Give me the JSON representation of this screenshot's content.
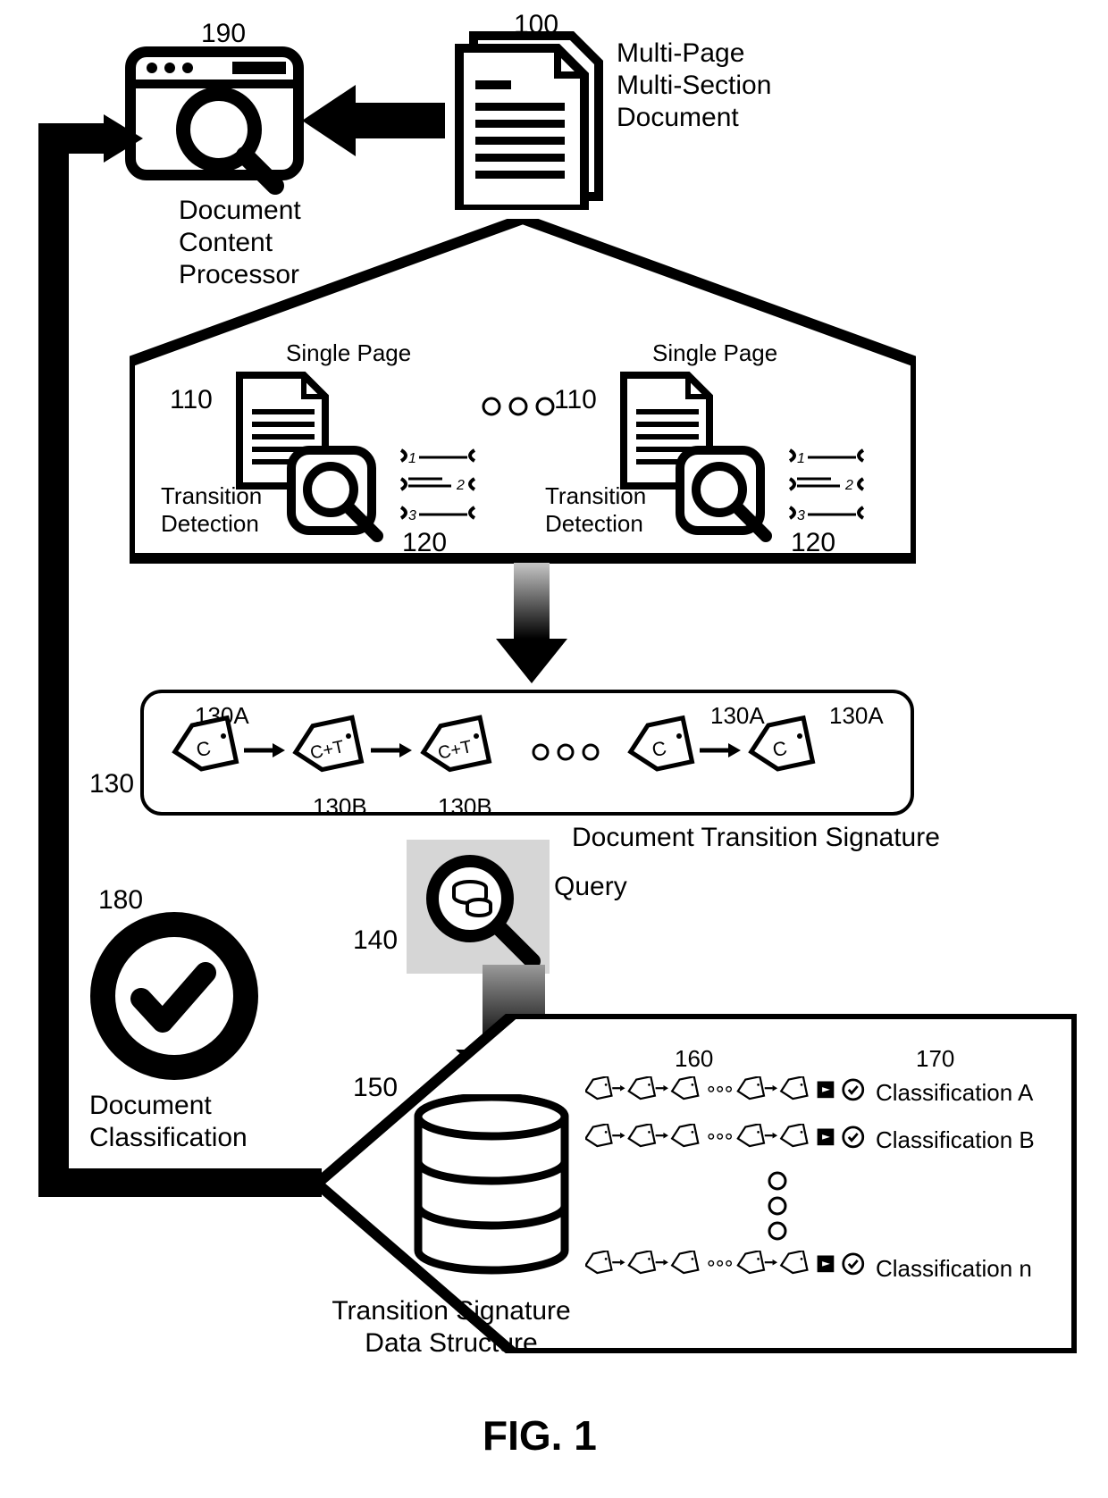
{
  "figure_label": "FIG. 1",
  "refs": {
    "doc": "100",
    "dcp": "190",
    "page_left": "110",
    "page_right": "110",
    "td_left": "120",
    "td_right": "120",
    "sig_box": "130",
    "tag_a1": "130A",
    "tag_b1": "130B",
    "tag_b2": "130B",
    "tag_a2": "130A",
    "tag_a3": "130A",
    "query": "140",
    "db": "150",
    "chain": "160",
    "class": "170",
    "result": "180"
  },
  "labels": {
    "doc": "Multi-Page\nMulti-Section\nDocument",
    "dcp": "Document\nContent\nProcessor",
    "single_page": "Single Page",
    "transition_detection": "Transition\nDetection",
    "sig_box": "Document Transition Signature",
    "query": "Query",
    "db": "Transition Signature\nData Structure",
    "classA": "Classification A",
    "classB": "Classification B",
    "classN": "Classification n",
    "result": "Document\nClassification",
    "tag_c": "C",
    "tag_ct": "C+T"
  }
}
